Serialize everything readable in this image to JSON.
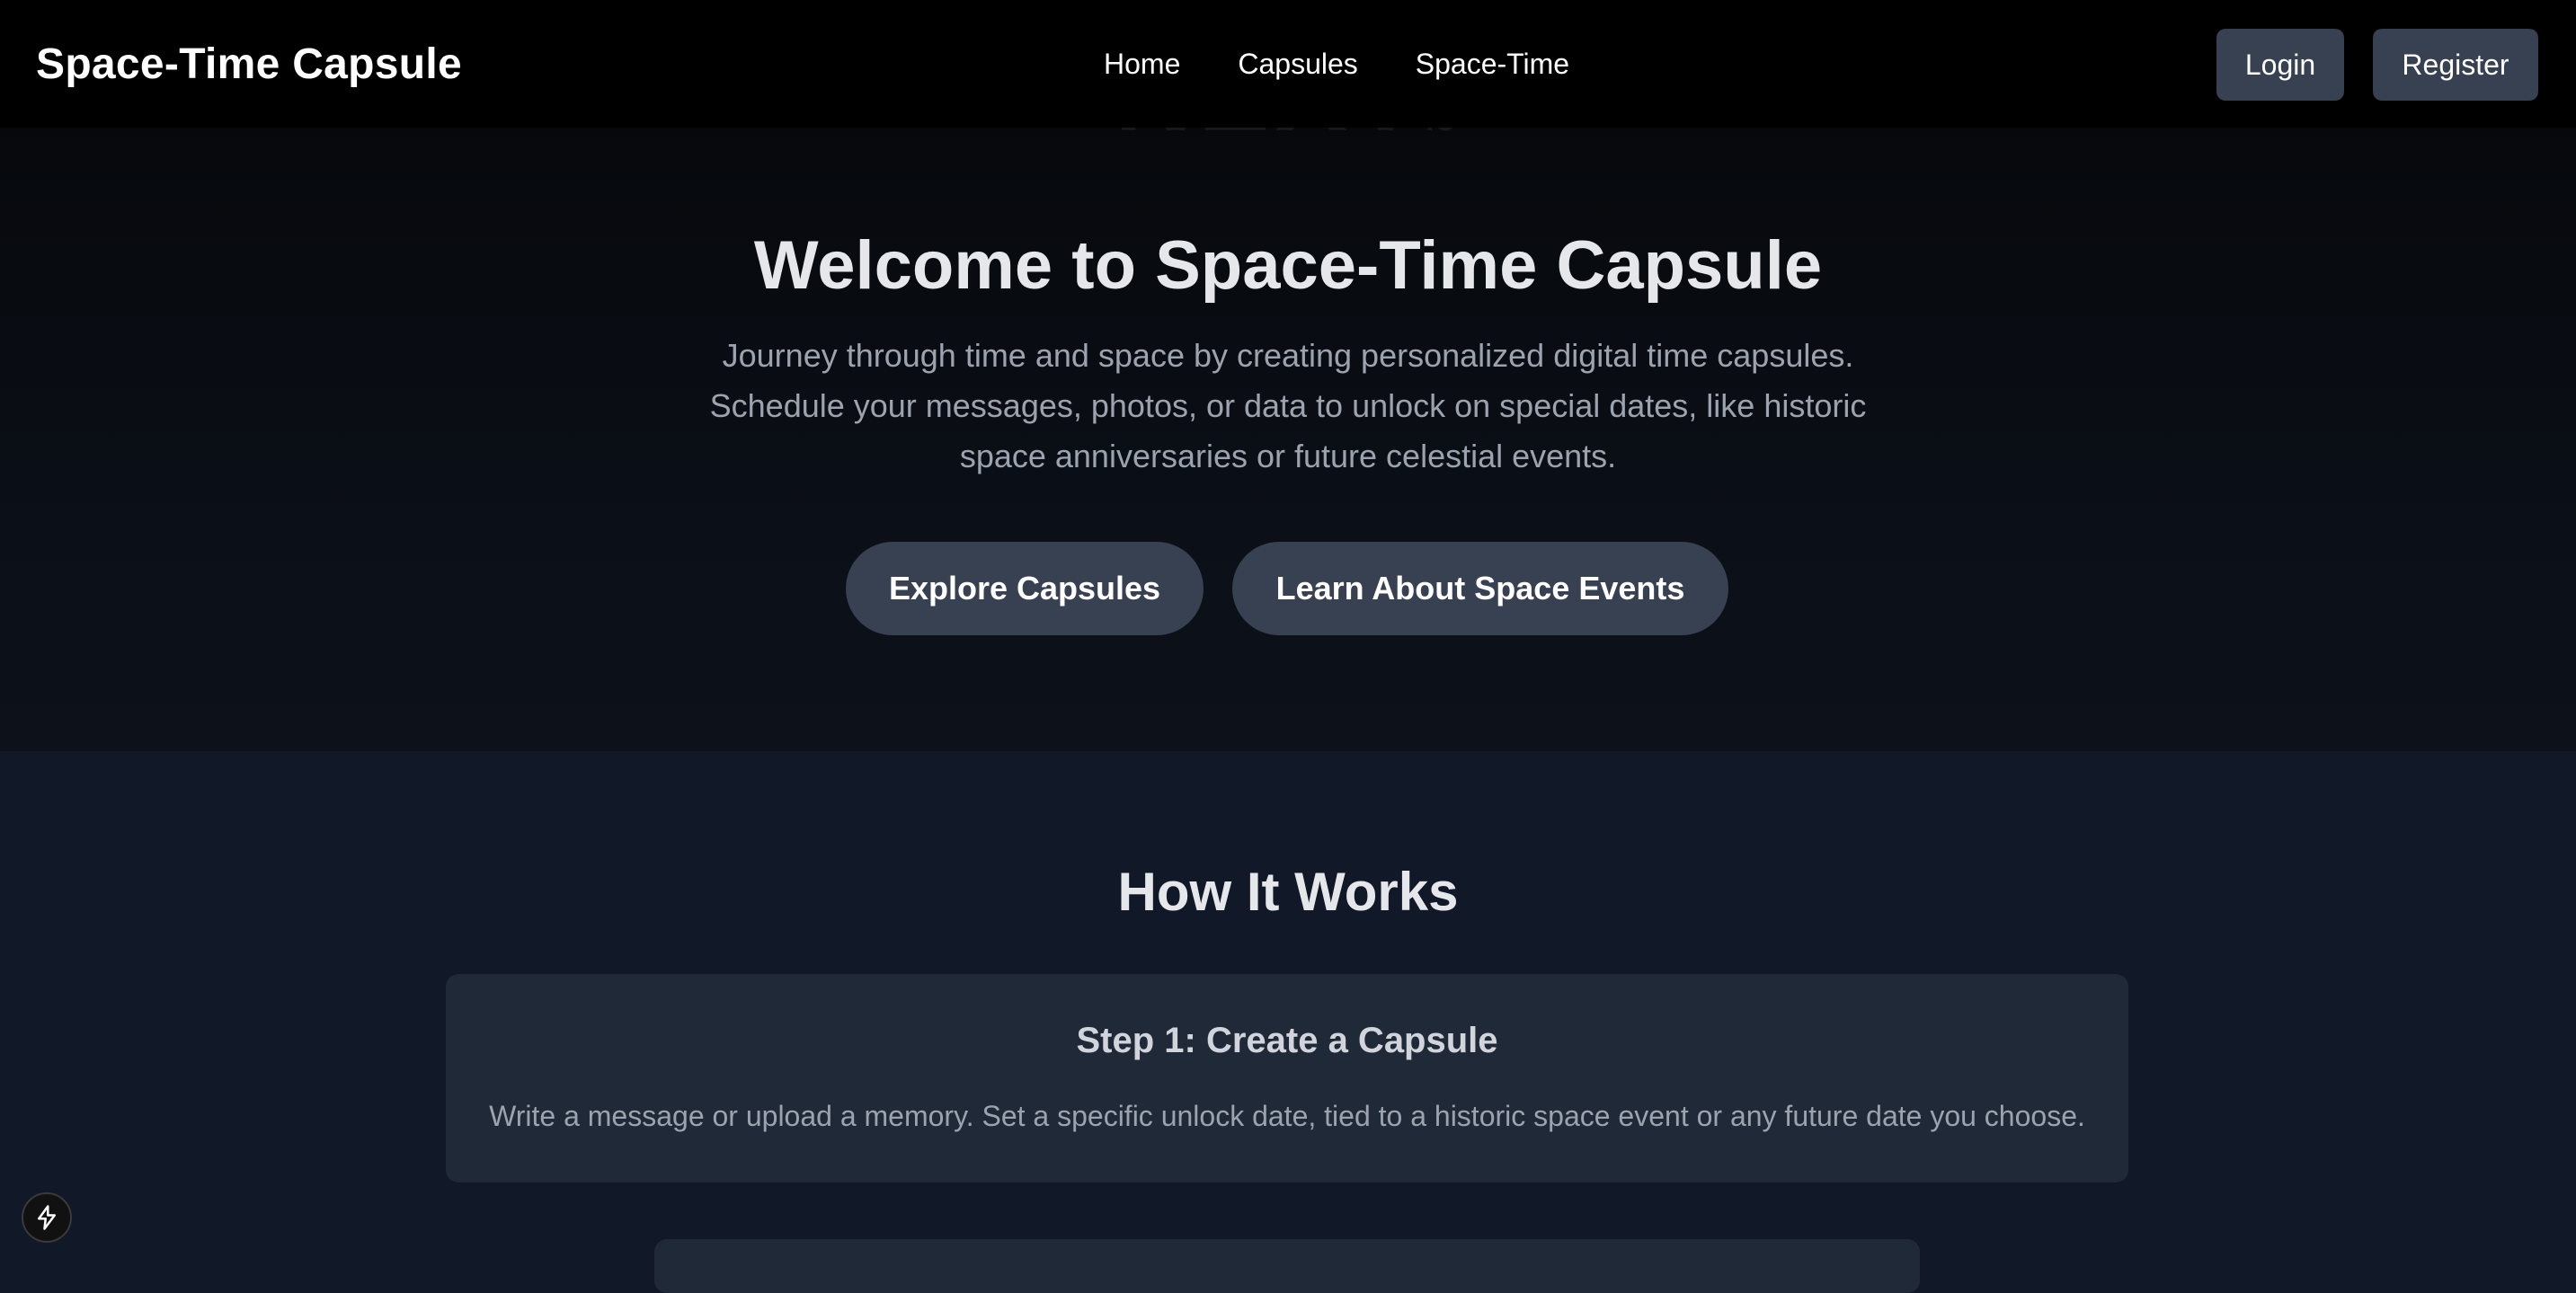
{
  "header": {
    "brand": "Space-Time Capsule",
    "nav": [
      {
        "label": "Home"
      },
      {
        "label": "Capsules"
      },
      {
        "label": "Space-Time"
      }
    ],
    "login_label": "Login",
    "register_label": "Register"
  },
  "hero": {
    "ghost_logo": "NEXT",
    "ghost_logo_suffix": ".JS",
    "title": "Welcome to Space-Time Capsule",
    "subtitle": "Journey through time and space by creating personalized digital time capsules. Schedule your messages, photos, or data to unlock on special dates, like historic space anniversaries or future celestial events.",
    "explore_label": "Explore Capsules",
    "learn_label": "Learn About Space Events"
  },
  "how_it_works": {
    "title": "How It Works",
    "steps": [
      {
        "title": "Step 1: Create a Capsule",
        "text": "Write a message or upload a memory. Set a specific unlock date, tied to a historic space event or any future date you choose."
      }
    ]
  },
  "badge": {
    "icon": "lightning-bolt-icon"
  },
  "colors": {
    "header_bg": "#000000",
    "button_bg": "#374151",
    "card_bg": "#1f2937",
    "page_bg": "#111827",
    "muted_text": "#9ca3af"
  }
}
